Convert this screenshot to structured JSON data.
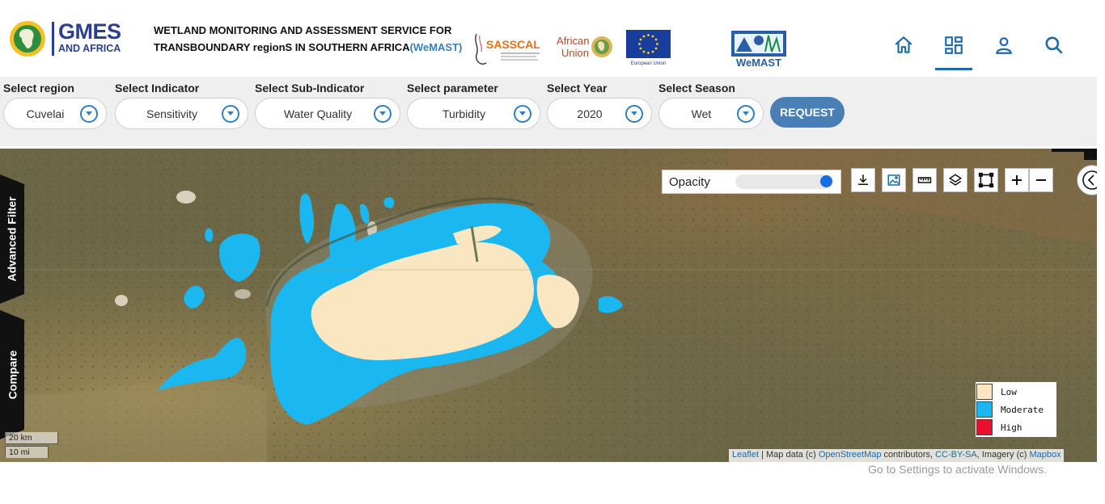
{
  "header": {
    "gmes_logo": {
      "line1": "GMES",
      "line2": "AND AFRICA"
    },
    "title_line1": "WETLAND MONITORING AND ASSESSMENT SERVICE FOR",
    "title_line2_prefix": "TRANSBOUNDARY regionS IN SOUTHERN AFRICA",
    "title_line2_suffix": "(WeMAST)",
    "partners": {
      "sasscal": "SASSCAL",
      "african_union": {
        "line1": "African",
        "line2": "Union"
      },
      "eu_caption": "European Union",
      "wemast": "WeMAST"
    },
    "nav": [
      {
        "icon": "home-icon"
      },
      {
        "icon": "dashboard-icon",
        "active": true
      },
      {
        "icon": "user-icon"
      },
      {
        "icon": "search-icon"
      }
    ]
  },
  "filters": [
    {
      "label": "Select region",
      "value": "Cuvelai"
    },
    {
      "label": "Select Indicator",
      "value": "Sensitivity"
    },
    {
      "label": "Select Sub-Indicator",
      "value": "Water Quality"
    },
    {
      "label": "Select parameter",
      "value": "Turbidity"
    },
    {
      "label": "Select Year",
      "value": "2020"
    },
    {
      "label": "Select Season",
      "value": "Wet"
    }
  ],
  "request_label": "REQUEST",
  "map": {
    "side_tabs": {
      "advanced_filter": "Advanced Filter",
      "compare": "Compare"
    },
    "opacity": {
      "label": "Opacity",
      "value": 1.0
    },
    "tools": [
      "download-icon",
      "image-icon",
      "ruler-icon",
      "layers-icon",
      "draw-rectangle-icon",
      "zoom-in-icon",
      "zoom-out-icon"
    ],
    "legend": [
      {
        "label": "Low",
        "color": "#fae7c1"
      },
      {
        "label": "Moderate",
        "color": "#1ab7f0"
      },
      {
        "label": "High",
        "color": "#e8112d"
      }
    ],
    "scale": {
      "metric": "20 km",
      "imperial": "10 mi"
    },
    "attribution": {
      "leaflet": "Leaflet",
      "sep1": " | Map data (c) ",
      "osm": "OpenStreetMap",
      "sep2": " contributors, ",
      "ccbysa": "CC-BY-SA",
      "sep3": ", Imagery (c) ",
      "mapbox": "Mapbox"
    }
  },
  "watermark": "Go to Settings to activate Windows."
}
